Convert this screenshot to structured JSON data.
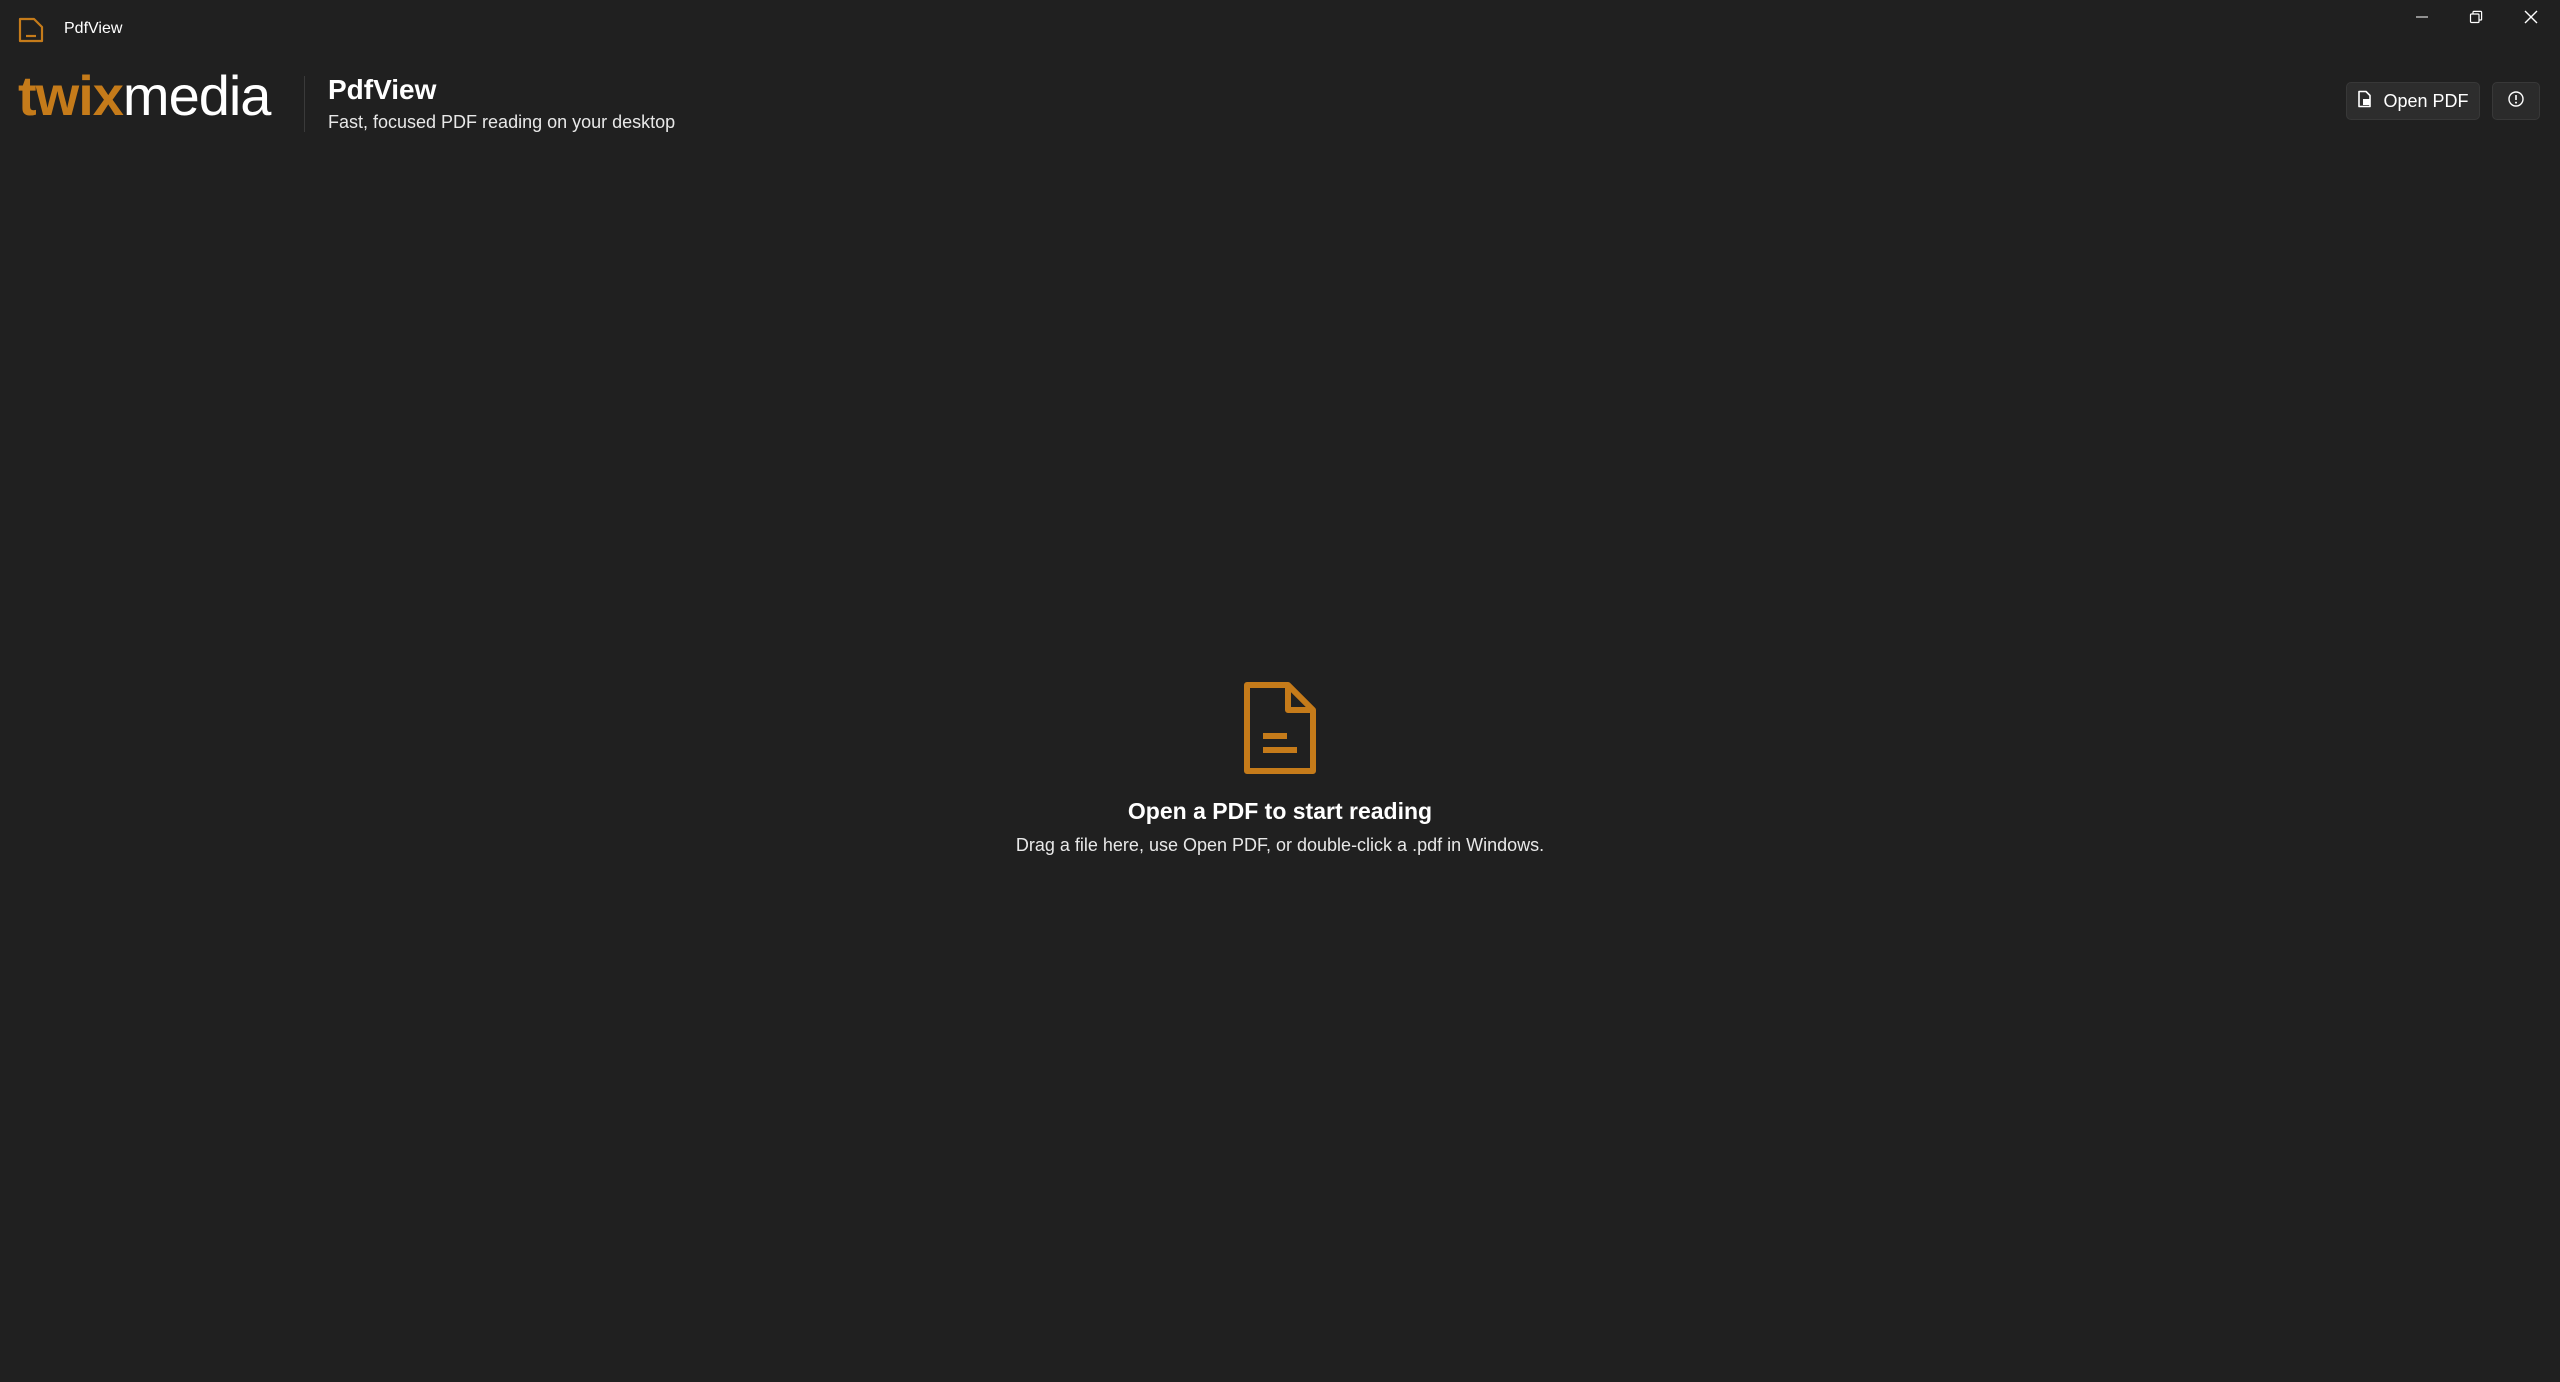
{
  "window": {
    "title": "PdfView",
    "app_icon": "pdf-file-icon",
    "controls": {
      "minimize_icon": "minimize-icon",
      "maximize_icon": "restore-icon",
      "close_icon": "close-icon"
    }
  },
  "header": {
    "logo_part1": "twix",
    "logo_part2": "media",
    "app_name": "PdfView",
    "tagline": "Fast, focused PDF reading on your desktop",
    "open_button_label": "Open PDF",
    "open_button_icon": "open-file-icon",
    "info_button_icon": "info-icon"
  },
  "empty_state": {
    "icon": "document-icon",
    "heading": "Open a PDF to start reading",
    "hint": "Drag a file here, use Open PDF, or double-click a .pdf in Windows."
  },
  "colors": {
    "background": "#202020",
    "accent": "#c57b1a",
    "text": "#ffffff",
    "button_bg": "#2d2d2d"
  }
}
